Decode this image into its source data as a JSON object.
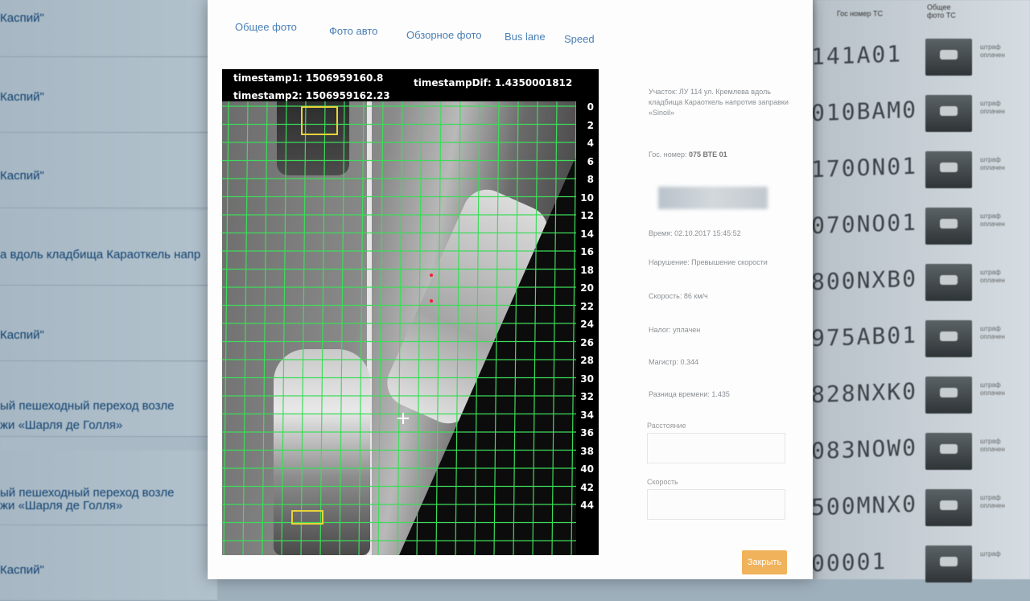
{
  "left_list": {
    "items": [
      {
        "text": "Каспий\""
      },
      {
        "text": "Каспий\""
      },
      {
        "text": "Каспий\""
      },
      {
        "text": "а вдоль кладбища Караоткель напр"
      },
      {
        "text": "Каспий\""
      },
      {
        "line1": "ый пешеходный переход возле",
        "line2": "жи «Шарля де Голля»"
      },
      {
        "line1": "ый пешеходный переход возле",
        "line2": "жи «Шарля де Голля»"
      },
      {
        "text": "Каспий\""
      }
    ]
  },
  "tabs": [
    {
      "label": "Общее фото"
    },
    {
      "label": "Фото авто"
    },
    {
      "label": "Обзорное фото"
    },
    {
      "label": "Bus lane"
    },
    {
      "label": "Speed"
    }
  ],
  "viewer": {
    "timestamp1": "timestamp1: 1506959160.8",
    "timestamp2": "timestamp2: 1506959162.23",
    "timestampDif": "timestampDif: 1.4350001812",
    "scale": [
      "0",
      "2",
      "4",
      "6",
      "8",
      "10",
      "12",
      "14",
      "16",
      "18",
      "20",
      "22",
      "24",
      "26",
      "28",
      "30",
      "32",
      "34",
      "36",
      "38",
      "40",
      "42",
      "44"
    ],
    "grid_color": "#3ddc5a",
    "box_color": "#e8d23a"
  },
  "info": {
    "location": "Участок: ЛУ 114 ул. Кремлева вдоль кладбища Караоткель напротив заправки «Sinoil»",
    "plate_label": "Гос. номер:",
    "plate_value": "075 ВТЕ 01",
    "time": "Время: 02.10.2017 15:45:52",
    "violation": "Нарушение: Превышение скорости",
    "speed": "Скорость: 86 км/ч",
    "tax": "Налог: уплачен",
    "mag": "Магистр: 0.344",
    "time_diff": "Разница времени: 1.435",
    "distance_label": "Расстояние",
    "speed_label": "Скорость",
    "submit": "Закрыть"
  },
  "right_list": {
    "header1": "Гос номер ТС",
    "header2": "Общее фото ТС",
    "rows": [
      {
        "plate": "141A01",
        "note": "штраф оплачен"
      },
      {
        "plate": "010BAM01",
        "note": "штраф оплачен"
      },
      {
        "plate": "170ON01",
        "note": "штраф оплачен"
      },
      {
        "plate": "070NO01",
        "note": "штраф оплачен"
      },
      {
        "plate": "800NXB01",
        "note": "штраф оплачен"
      },
      {
        "plate": "975AB01",
        "note": "штраф оплачен"
      },
      {
        "plate": "828NXK01",
        "note": "штраф оплачен"
      },
      {
        "plate": "083NOW01",
        "note": "штраф оплачен"
      },
      {
        "plate": "500MNX01",
        "note": "штраф оплачен"
      },
      {
        "plate": "00001",
        "note": "штраф"
      }
    ]
  }
}
